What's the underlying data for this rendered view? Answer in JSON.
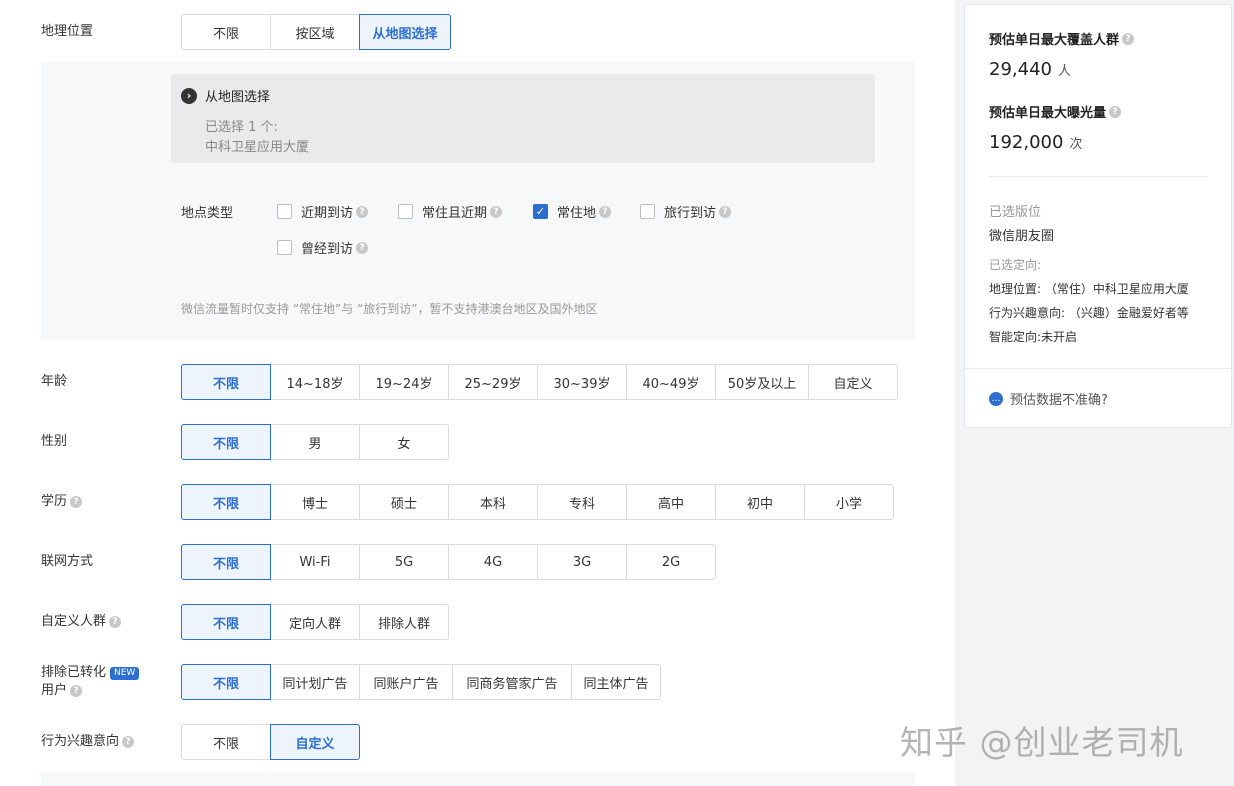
{
  "geo": {
    "label": "地理位置",
    "options": [
      "不限",
      "按区域",
      "从地图选择"
    ],
    "map_title": "从地图选择",
    "selected_count": "已选择 1 个:",
    "selected_place": "中科卫星应用大厦",
    "loc_type_label": "地点类型",
    "loc_types": [
      "近期到访",
      "常住且近期",
      "常住地",
      "旅行到访",
      "曾经到访"
    ],
    "note": "微信流量暂时仅支持 “常住地”与 “旅行到访”，暂不支持港澳台地区及国外地区"
  },
  "age": {
    "label": "年龄",
    "options": [
      "不限",
      "14~18岁",
      "19~24岁",
      "25~29岁",
      "30~39岁",
      "40~49岁",
      "50岁及以上",
      "自定义"
    ]
  },
  "gender": {
    "label": "性别",
    "options": [
      "不限",
      "男",
      "女"
    ]
  },
  "education": {
    "label": "学历",
    "options": [
      "不限",
      "博士",
      "硕士",
      "本科",
      "专科",
      "高中",
      "初中",
      "小学"
    ]
  },
  "network": {
    "label": "联网方式",
    "options": [
      "不限",
      "Wi-Fi",
      "5G",
      "4G",
      "3G",
      "2G"
    ]
  },
  "custom_audience": {
    "label": "自定义人群",
    "options": [
      "不限",
      "定向人群",
      "排除人群"
    ]
  },
  "exclude_converted": {
    "label_line1": "排除已转化",
    "badge": "NEW",
    "label_line2": "用户",
    "options": [
      "不限",
      "同计划广告",
      "同账户广告",
      "同商务管家广告",
      "同主体广告"
    ]
  },
  "interest": {
    "label": "行为兴趣意向",
    "options": [
      "不限",
      "自定义"
    ]
  },
  "summary": {
    "reach_label": "预估单日最大覆盖人群",
    "reach_value": "29,440",
    "reach_unit": "人",
    "exposure_label": "预估单日最大曝光量",
    "exposure_value": "192,000",
    "exposure_unit": "次",
    "placement_label": "已选版位",
    "placement_value": "微信朋友圈",
    "targeting_label": "已选定向:",
    "targeting_geo": "地理位置: （常住）中科卫星应用大厦",
    "targeting_interest": "行为兴趣意向: （兴趣）金融爱好者等",
    "targeting_smart": "智能定向:未开启",
    "help_text": "预估数据不准确?"
  },
  "watermark": "知乎 @创业老司机",
  "colors": {
    "accent": "#2c6fd1",
    "panel_bg": "#f7f8f9",
    "side_bg": "#f2f3f5"
  }
}
